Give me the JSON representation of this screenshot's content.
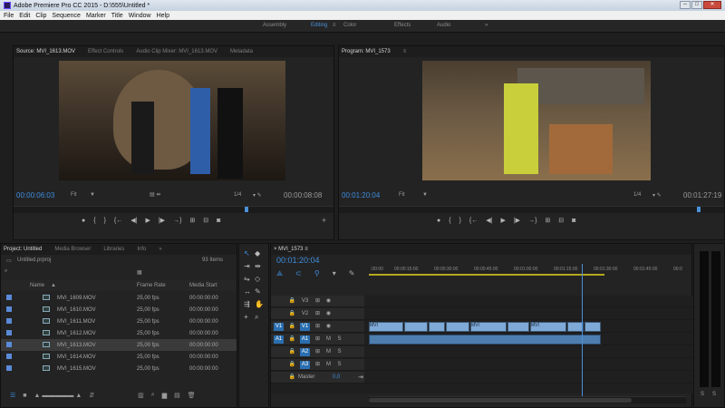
{
  "titlebar": {
    "title": "Adobe Premiere Pro CC 2015 - D:\\555\\Untitled *"
  },
  "menu": [
    "File",
    "Edit",
    "Clip",
    "Sequence",
    "Marker",
    "Title",
    "Window",
    "Help"
  ],
  "workspaces": [
    {
      "label": "Assembly",
      "active": false
    },
    {
      "label": "Editing",
      "active": true
    },
    {
      "label": "Color",
      "active": false
    },
    {
      "label": "Effects",
      "active": false
    },
    {
      "label": "Audio",
      "active": false
    },
    {
      "label": "»",
      "active": false
    }
  ],
  "source_panel": {
    "tabs": [
      "Source: MVI_1613.MOV",
      "Effect Controls",
      "Audio Clip Mixer: MVI_1613.MOV",
      "Metadata"
    ],
    "timecode": "00:00:06:03",
    "fit": "Fit",
    "resolution": "1/4",
    "duration": "00:00:08:08"
  },
  "program_panel": {
    "tab": "Program: MVI_1573",
    "timecode": "00:01:20:04",
    "fit": "Fit",
    "resolution": "1/4",
    "duration": "00:01:27:19"
  },
  "project_panel": {
    "tabs": [
      "Project: Untitled",
      "Media Browser",
      "Libraries",
      "Info",
      "»"
    ],
    "project_file": "Untitled.prproj",
    "item_count": "93 Items",
    "columns": {
      "name": "Name",
      "frame_rate": "Frame Rate",
      "media_start": "Media Start"
    },
    "rows": [
      {
        "name": "MVI_1609.MOV",
        "frame_rate": "25,00 fps",
        "media_start": "00:00:00:00"
      },
      {
        "name": "MVI_1610.MOV",
        "frame_rate": "25,00 fps",
        "media_start": "00:00:00:00"
      },
      {
        "name": "MVI_1611.MOV",
        "frame_rate": "25,00 fps",
        "media_start": "00:00:00:00"
      },
      {
        "name": "MVI_1612.MOV",
        "frame_rate": "25,00 fps",
        "media_start": "00:00:00:00"
      },
      {
        "name": "MVI_1613.MOV",
        "frame_rate": "25,00 fps",
        "media_start": "00:00:00:00"
      },
      {
        "name": "MVI_1614.MOV",
        "frame_rate": "25,00 fps",
        "media_start": "00:00:00:00"
      },
      {
        "name": "MVI_1615.MOV",
        "frame_rate": "25,00 fps",
        "media_start": "00:00:00:00"
      }
    ]
  },
  "timeline": {
    "tab": "MVI_1573",
    "timecode": "00:01:20:04",
    "ruler": [
      ";00:00",
      "00:00:15:00",
      "00:00:30:00",
      "00:00:45:00",
      "00:01:00:00",
      "00:01:15:00",
      "00:01:30:00",
      "00:01:45:00",
      "00:0"
    ],
    "tracks": {
      "v3": "V3",
      "v2": "V2",
      "v1_src": "V1",
      "v1": "V1",
      "a1_src": "A1",
      "a1": "A1",
      "a2": "A2",
      "a3": "A3",
      "master": "Master",
      "master_val": "0,0"
    },
    "clip_labels": [
      "MVI",
      "MVI",
      "MVI"
    ]
  },
  "meters": {
    "labels": [
      "S",
      "S"
    ]
  },
  "colors": {
    "accent": "#3e8ddd",
    "clip_video": "#7fa9d6",
    "clip_audio": "#4e7eb0",
    "playhead": "#4a90d9"
  }
}
